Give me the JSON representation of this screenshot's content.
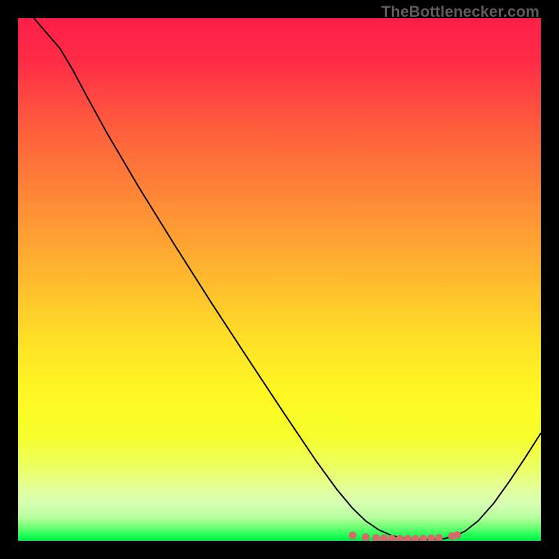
{
  "watermark": "TheBottlenecker.com",
  "chart_data": {
    "type": "line",
    "title": "",
    "xlabel": "",
    "ylabel": "",
    "xlim": [
      0,
      100
    ],
    "ylim": [
      0,
      100
    ],
    "grid": false,
    "background_gradient": {
      "stops": [
        {
          "offset": 0.0,
          "color": "#ff1f49"
        },
        {
          "offset": 0.08,
          "color": "#ff2b46"
        },
        {
          "offset": 0.2,
          "color": "#ff5a3e"
        },
        {
          "offset": 0.35,
          "color": "#ff8a36"
        },
        {
          "offset": 0.5,
          "color": "#ffba2e"
        },
        {
          "offset": 0.62,
          "color": "#ffe127"
        },
        {
          "offset": 0.72,
          "color": "#fff823"
        },
        {
          "offset": 0.8,
          "color": "#f6ff2a"
        },
        {
          "offset": 0.86,
          "color": "#ecff64"
        },
        {
          "offset": 0.9,
          "color": "#e4ff9a"
        },
        {
          "offset": 0.93,
          "color": "#d6ffb3"
        },
        {
          "offset": 0.955,
          "color": "#b8ff9e"
        },
        {
          "offset": 0.975,
          "color": "#6cff72"
        },
        {
          "offset": 0.99,
          "color": "#1cff54"
        },
        {
          "offset": 1.0,
          "color": "#00e84a"
        }
      ]
    },
    "series": [
      {
        "name": "bottleneck-curve",
        "color": "#000000",
        "width": 2,
        "x": [
          3.0,
          8.0,
          10.5,
          13.0,
          17.0,
          23.0,
          30.0,
          37.0,
          44.0,
          51.0,
          57.0,
          61.0,
          64.0,
          66.5,
          69.0,
          71.5,
          74.0,
          76.5,
          79.0,
          81.5,
          83.5,
          85.5,
          88.0,
          91.0,
          94.0,
          97.0,
          100.0
        ],
        "y": [
          100.0,
          94.2,
          90.0,
          85.3,
          78.0,
          67.8,
          56.5,
          45.5,
          34.8,
          24.2,
          15.3,
          9.8,
          6.2,
          3.8,
          2.1,
          1.0,
          0.46,
          0.24,
          0.22,
          0.42,
          0.92,
          1.85,
          3.8,
          7.2,
          11.4,
          15.9,
          20.6
        ]
      }
    ],
    "markers": {
      "name": "optimal-range",
      "color": "#d46a6a",
      "radius": 5.5,
      "points": [
        {
          "x": 64.0,
          "y": 1.05
        },
        {
          "x": 66.5,
          "y": 0.7
        },
        {
          "x": 68.5,
          "y": 0.55
        },
        {
          "x": 70.0,
          "y": 0.48
        },
        {
          "x": 71.5,
          "y": 0.42
        },
        {
          "x": 73.0,
          "y": 0.4
        },
        {
          "x": 74.5,
          "y": 0.4
        },
        {
          "x": 76.0,
          "y": 0.4
        },
        {
          "x": 77.5,
          "y": 0.42
        },
        {
          "x": 79.0,
          "y": 0.48
        },
        {
          "x": 80.5,
          "y": 0.58
        },
        {
          "x": 83.0,
          "y": 0.9
        },
        {
          "x": 84.0,
          "y": 1.1
        }
      ]
    }
  }
}
